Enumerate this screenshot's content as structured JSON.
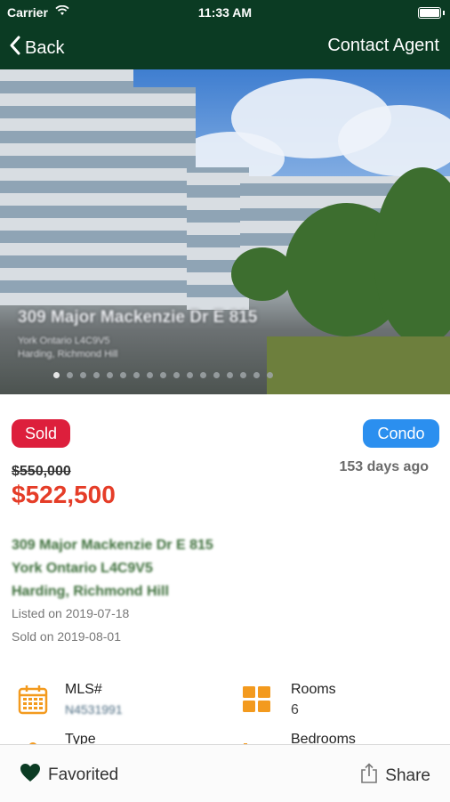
{
  "status_bar": {
    "carrier": "Carrier",
    "time": "11:33 AM",
    "wifi_icon": "wifi-icon",
    "battery_icon": "battery-icon"
  },
  "nav": {
    "back_label": "Back",
    "contact_label": "Contact Agent"
  },
  "hero": {
    "title": "309 Major Mackenzie Dr E 815",
    "sub_line1": "York Ontario L4C9V5",
    "sub_line2": "Harding, Richmond Hill",
    "photo_count": 17,
    "active_index": 0
  },
  "listing": {
    "status_badge": "Sold",
    "type_badge": "Condo",
    "original_price": "$550,000",
    "days_ago": "153 days ago",
    "price": "$522,500",
    "address_line1": "309 Major Mackenzie Dr E 815",
    "address_line2": "York Ontario L4C9V5",
    "address_line3": "Harding, Richmond Hill",
    "listed_on": "Listed on 2019-07-18",
    "sold_on": "Sold on 2019-08-01"
  },
  "details": {
    "mls_label": "MLS#",
    "mls_value": "N4531991",
    "rooms_label": "Rooms",
    "rooms_value": "6",
    "type_label": "Type",
    "bedrooms_label": "Bedrooms"
  },
  "tabbar": {
    "favorited_label": "Favorited",
    "share_label": "Share"
  },
  "colors": {
    "nav_bg": "#0b3b23",
    "sold": "#dd1f3c",
    "condo": "#2b8fef",
    "price": "#e53d28",
    "accent": "#f39a1e"
  }
}
